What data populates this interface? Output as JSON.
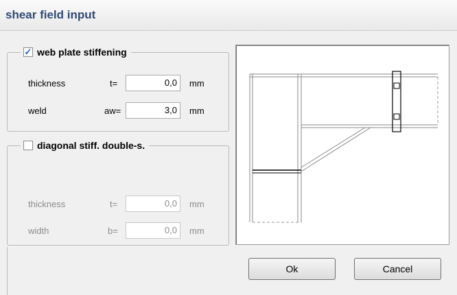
{
  "window": {
    "title": "shear field input"
  },
  "web_plate": {
    "label": "web plate stiffening",
    "checked": true,
    "thickness": {
      "label": "thickness",
      "symbol": "t=",
      "value": "0,0",
      "unit": "mm"
    },
    "weld": {
      "label": "weld",
      "symbol": "aw=",
      "value": "3,0",
      "unit": "mm"
    }
  },
  "diagonal": {
    "label": "diagonal stiff. double-s.",
    "checked": false,
    "thickness": {
      "label": "thickness",
      "symbol": "t=",
      "value": "0,0",
      "unit": "mm"
    },
    "width": {
      "label": "width",
      "symbol": "b=",
      "value": "0,0",
      "unit": "mm"
    }
  },
  "buttons": {
    "ok": "Ok",
    "cancel": "Cancel"
  },
  "colors": {
    "title": "#2f4a74",
    "check": "#1c5fbf"
  }
}
